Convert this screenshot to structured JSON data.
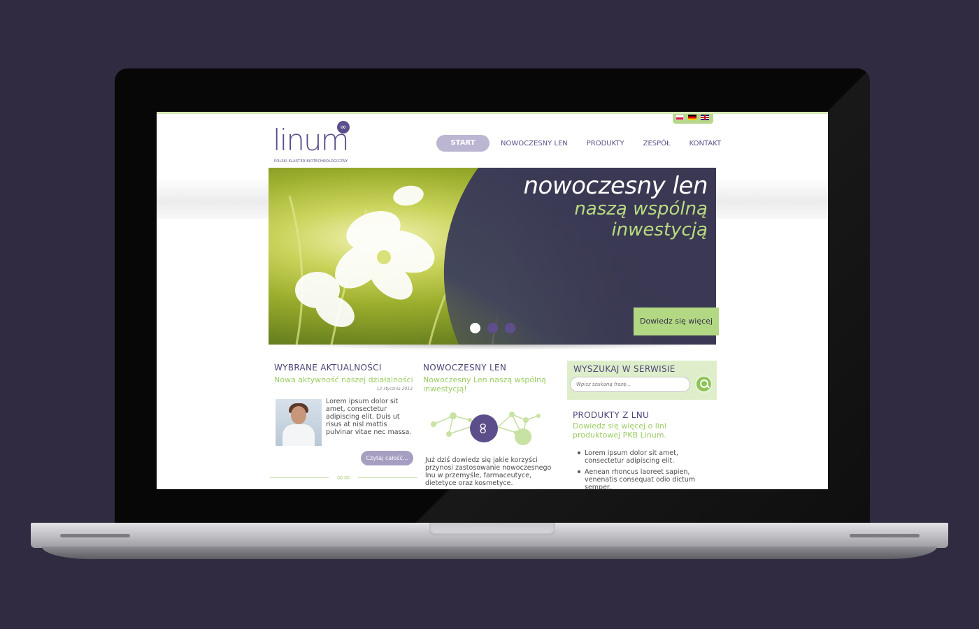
{
  "header": {
    "logo_text": "linum",
    "logo_tagline": "POLSKI KLASTER BIOTECHNOLOGICZNY",
    "nav": [
      {
        "label": "START"
      },
      {
        "label": "NOWOCZESNY LEN"
      },
      {
        "label": "PRODUKTY"
      },
      {
        "label": "ZESPÓŁ"
      },
      {
        "label": "KONTAKT"
      }
    ],
    "languages": [
      "pl-flag-icon",
      "de-flag-icon",
      "gb-flag-icon"
    ]
  },
  "hero": {
    "line1": "nowoczesny len",
    "line2": "naszą wspólną",
    "line3": "inwestycją",
    "cta_label": "Dowiedz się więcej",
    "slides": 3,
    "active_slide": 1
  },
  "news": {
    "title": "WYBRANE AKTUALNOŚCI",
    "subtitle": "Nowa aktywność naszej działalności",
    "date": "12 stycznia 2013",
    "text": "Lorem ipsum dolor sit amet, consectetur adipiscing elit. Duis ut risus at nisl mattis pulvinar vitae nec massa.",
    "button": "Czytaj całość..."
  },
  "modern_flax": {
    "title": "NOWOCZESNY LEN",
    "subtitle": "Nowoczesny Len naszą wspólną inwestycją!",
    "text": "Już dziś dowiedz się jakie korzyści przynosi zastosowanie nowoczesnego lnu w przemyśle, farmaceutyce, dietetyce oraz kosmetyce."
  },
  "search": {
    "title": "WYSZUKAJ W SERWISIE",
    "placeholder": "Wpisz szukaną frazę..."
  },
  "products": {
    "title": "PRODUKTY Z LNU",
    "subtitle": "Dowiedz się więcej o lini produktowej PKB Linum.",
    "items": [
      "Lorem ipsum dolor sit amet, consectetur adipiscing elit.",
      "Aenean rhoncus laoreet sapien, venenatis consequat odio dictum semper."
    ]
  },
  "colors": {
    "brand_purple": "#5c4e8a",
    "brand_green": "#9ccc63",
    "background": "#302b41"
  }
}
